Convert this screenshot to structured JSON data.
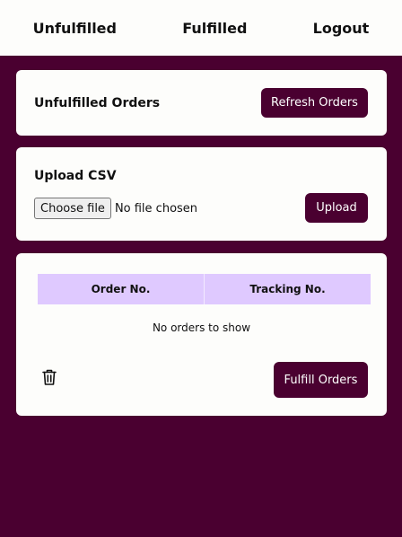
{
  "nav": {
    "unfulfilled": "Unfulfilled",
    "fulfilled": "Fulfilled",
    "logout": "Logout"
  },
  "orders_card": {
    "title": "Unfulfilled Orders",
    "refresh_label": "Refresh Orders"
  },
  "upload_card": {
    "title": "Upload CSV",
    "choose_file_label": "Choose file",
    "file_status": "No file chosen",
    "upload_label": "Upload"
  },
  "table_card": {
    "columns": [
      "Order No.",
      "Tracking No."
    ],
    "empty_message": "No orders to show",
    "delete_icon": "trash-icon",
    "fulfill_label": "Fulfill Orders"
  },
  "colors": {
    "brand": "#4a0030",
    "table_header": "#dfc9ff",
    "card_bg": "#fdfdfb"
  }
}
